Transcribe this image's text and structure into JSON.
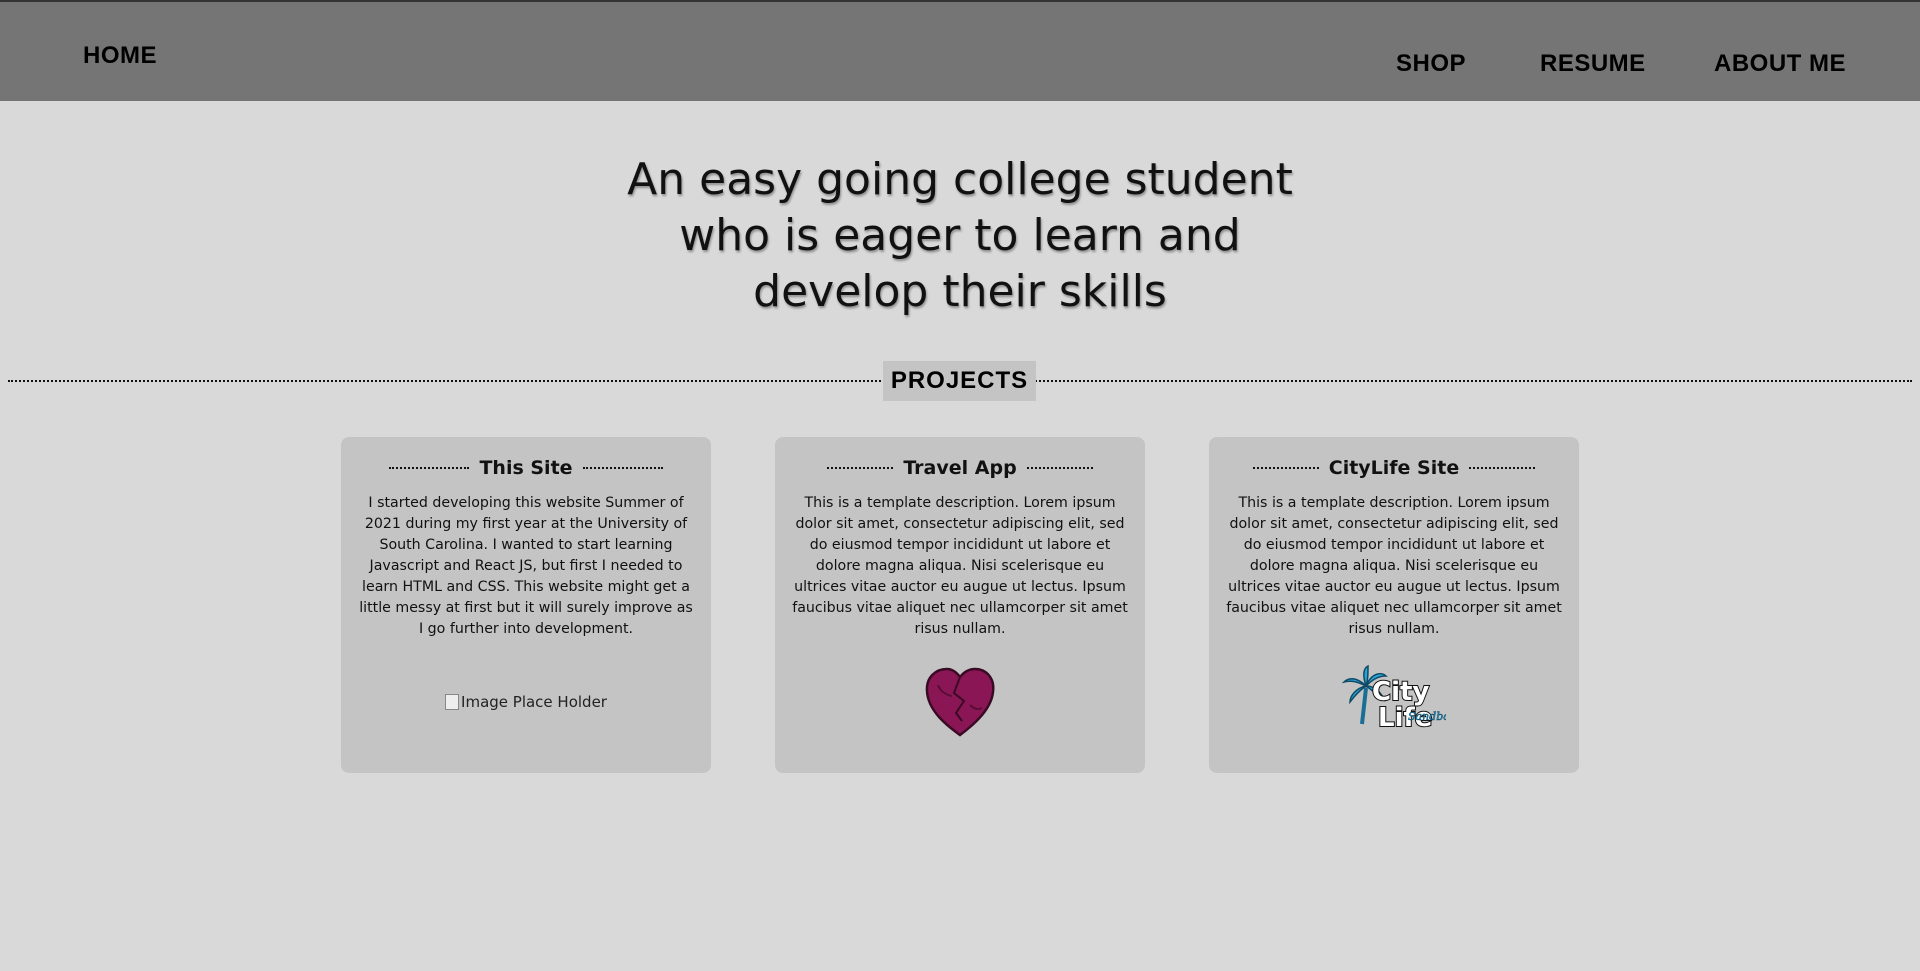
{
  "nav": {
    "home": "HOME",
    "shop": "SHOP",
    "resume": "RESUME",
    "about": "ABOUT ME"
  },
  "hero": {
    "line1": "An easy going college student",
    "line2": "who is eager to learn and",
    "line3": "develop their skills"
  },
  "projects_label": "PROJECTS",
  "cards": [
    {
      "title": "This Site",
      "description": "I started developing this website Summer of 2021 during my first year at the University of South Carolina. I wanted to start learning Javascript and React JS, but first I needed to learn HTML and CSS. This website might get a little messy at first but it will surely improve as I go further into development.",
      "image_alt": "Image Place Holder"
    },
    {
      "title": "Travel App",
      "description": "This is a template description. Lorem ipsum dolor sit amet, consectetur adipiscing elit, sed do eiusmod tempor incididunt ut labore et dolore magna aliqua. Nisi scelerisque eu ultrices vitae auctor eu augue ut lectus. Ipsum faucibus vitae aliquet nec ullamcorper sit amet risus nullam.",
      "image_icon": "broken-heart-icon"
    },
    {
      "title": "CityLife Site",
      "description": "This is a template description. Lorem ipsum dolor sit amet, consectetur adipiscing elit, sed do eiusmod tempor incididunt ut labore et dolore magna aliqua. Nisi scelerisque eu ultrices vitae auctor eu augue ut lectus. Ipsum faucibus vitae aliquet nec ullamcorper sit amet risus nullam.",
      "image_logo_text": "City Life",
      "image_icon": "citylife-logo"
    }
  ],
  "colors": {
    "page_bg": "#d9d9d9",
    "navbar_bg": "#757575",
    "card_bg": "#c4c4c4",
    "heart": "#8b1656",
    "palm": "#2aa3d4"
  }
}
